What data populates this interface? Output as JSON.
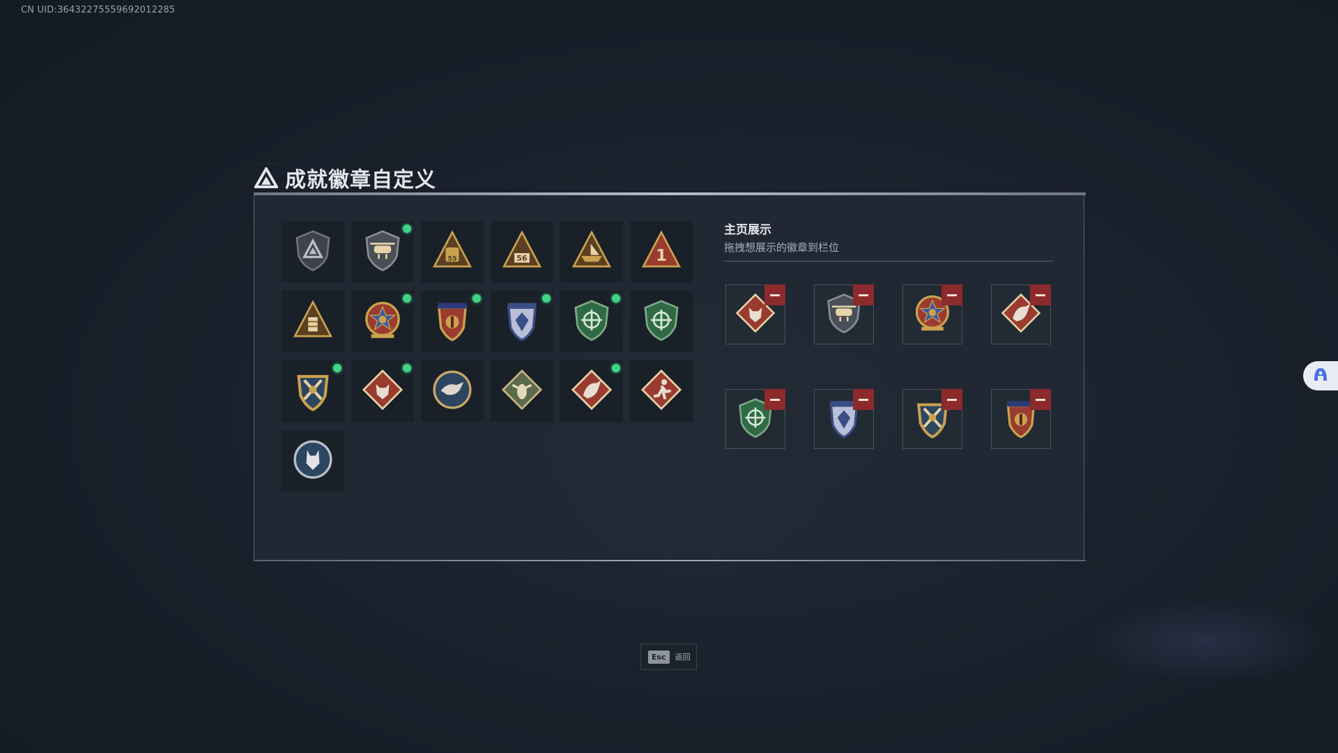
{
  "uid": "CN UID:36432275559692012285",
  "title": "成就徽章自定义",
  "title_tick": "...... .... ....",
  "showcase": {
    "title": "主页展示",
    "hint": "拖拽想展示的徽章到栏位"
  },
  "badges": [
    {
      "icon": "grey-triangle-shield-badge",
      "new": false
    },
    {
      "icon": "helicopter-shield-badge",
      "new": true
    },
    {
      "icon": "gold-triangle-55-badge",
      "new": false
    },
    {
      "icon": "gold-triangle-56-badge",
      "new": false
    },
    {
      "icon": "gold-triangle-ship-badge",
      "new": false
    },
    {
      "icon": "gold-triangle-number-1-badge",
      "new": false
    },
    {
      "icon": "gold-triangle-stack-badge",
      "new": false
    },
    {
      "icon": "star-medal-badge",
      "new": true
    },
    {
      "icon": "red-crest-badge",
      "new": true
    },
    {
      "icon": "blue-wolf-crest-badge",
      "new": true
    },
    {
      "icon": "green-crosshair-shield-badge",
      "new": true
    },
    {
      "icon": "green-crosshair-shield-badge",
      "new": false
    },
    {
      "icon": "gold-swords-crest-badge",
      "new": true
    },
    {
      "icon": "diamond-wolf-badge",
      "new": true
    },
    {
      "icon": "round-eagle-badge",
      "new": false
    },
    {
      "icon": "diamond-hornet-badge",
      "new": false
    },
    {
      "icon": "diamond-dragon-badge",
      "new": true
    },
    {
      "icon": "diamond-runner-badge",
      "new": false
    },
    {
      "icon": "round-wolf-badge",
      "new": false
    }
  ],
  "showcase_slots": [
    {
      "icon": "diamond-wolf-badge"
    },
    {
      "icon": "helicopter-shield-badge"
    },
    {
      "icon": "star-medal-badge"
    },
    {
      "icon": "diamond-dragon-badge"
    },
    {
      "icon": "green-crosshair-shield-badge"
    },
    {
      "icon": "blue-wolf-crest-badge"
    },
    {
      "icon": "gold-swords-crest-badge"
    },
    {
      "icon": "red-crest-badge"
    }
  ],
  "esc": {
    "key": "Esc",
    "label": "返回"
  },
  "colors": {
    "new_dot": "#3fd487",
    "remove": "#8c2a2c",
    "panel": "#222934"
  }
}
